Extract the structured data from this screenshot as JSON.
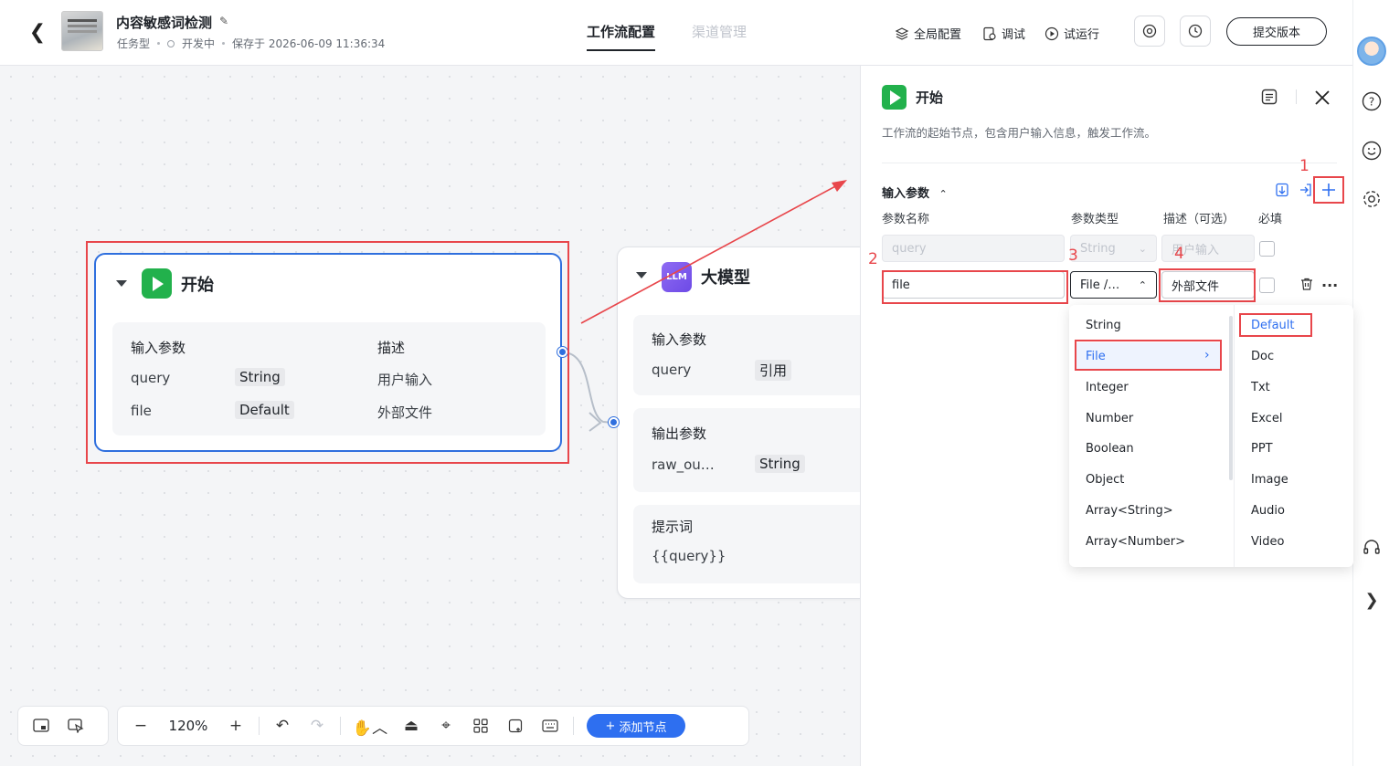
{
  "header": {
    "app_title": "内容敏感词检测",
    "type_label": "任务型",
    "status_label": "开发中",
    "saved_label": "保存于 2026-06-09 11:36:34",
    "tabs": [
      {
        "label": "工作流配置",
        "active": true
      },
      {
        "label": "渠道管理",
        "active": false
      }
    ],
    "actions": {
      "global_config": "全局配置",
      "debug": "调试",
      "trial_run": "试运行",
      "submit": "提交版本"
    },
    "icons": [
      "back-icon",
      "edit-icon",
      "layers-icon",
      "debug-icon",
      "play-circle-icon",
      "bug-icon",
      "history-icon"
    ]
  },
  "canvas": {
    "start_node": {
      "title": "开始",
      "section_label": "输入参数",
      "desc_label": "描述",
      "params": [
        {
          "name": "query",
          "type": "String",
          "desc": "用户输入"
        },
        {
          "name": "file",
          "type": "Default",
          "desc": "外部文件"
        }
      ]
    },
    "llm_node": {
      "badge": "LLM",
      "title": "大模型",
      "input_label": "输入参数",
      "input_param": {
        "name": "query",
        "type": "引用"
      },
      "output_label": "输出参数",
      "output_param": {
        "name": "raw_ou…",
        "type": "String"
      },
      "prompt_label": "提示词",
      "prompt_value": "{{query}}"
    },
    "toolbar": {
      "zoom": "120%",
      "add_node": "添加节点"
    }
  },
  "panel": {
    "title": "开始",
    "description": "工作流的起始节点，包含用户输入信息，触发工作流。",
    "section_title": "输入参数",
    "col_name": "参数名称",
    "col_type": "参数类型",
    "col_desc": "描述（可选）",
    "col_required": "必填",
    "rows": [
      {
        "name": "query",
        "type": "String",
        "desc": "用户输入",
        "disabled": true
      },
      {
        "name": "file",
        "type": "File /…",
        "desc": "外部文件",
        "disabled": false
      }
    ],
    "annotations": [
      "1",
      "2",
      "3",
      "4"
    ],
    "dropdown": {
      "types": [
        "String",
        "File",
        "Integer",
        "Number",
        "Boolean",
        "Object",
        "Array<String>",
        "Array<Number>"
      ],
      "selected_type": "File",
      "file_subtypes": [
        "Default",
        "Doc",
        "Txt",
        "Excel",
        "PPT",
        "Image",
        "Audio",
        "Video"
      ],
      "selected_subtype": "Default"
    }
  },
  "colors": {
    "accent": "#2e6ff0",
    "start_green": "#22b14c",
    "llm_purple": "#7b5cf0",
    "annotation_red": "#e8464b"
  }
}
